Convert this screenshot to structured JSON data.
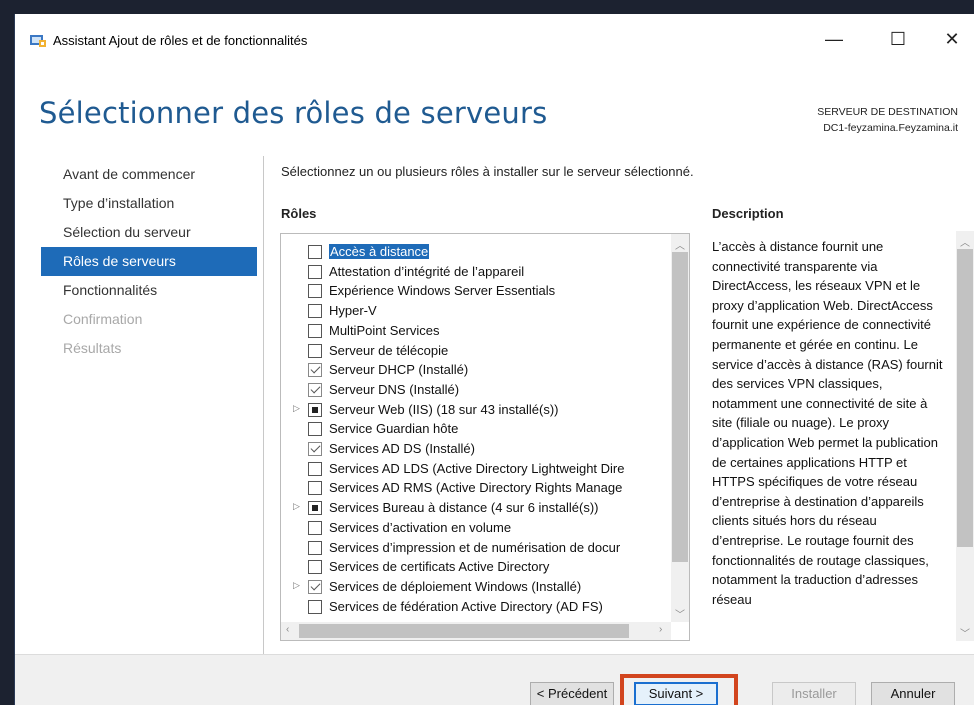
{
  "window": {
    "title": "Assistant Ajout de rôles et de fonctionnalités",
    "minimize": "—",
    "maximize": "☐",
    "close": "✕"
  },
  "header": {
    "page_title": "Sélectionner des rôles de serveurs",
    "dest_label": "SERVEUR DE DESTINATION",
    "dest_server": "DC1-feyzamina.Feyzamina.it"
  },
  "nav": {
    "items": [
      {
        "label": "Avant de commencer",
        "state": "normal"
      },
      {
        "label": "Type d’installation",
        "state": "normal"
      },
      {
        "label": "Sélection du serveur",
        "state": "normal"
      },
      {
        "label": "Rôles de serveurs",
        "state": "active"
      },
      {
        "label": "Fonctionnalités",
        "state": "normal"
      },
      {
        "label": "Confirmation",
        "state": "disabled"
      },
      {
        "label": "Résultats",
        "state": "disabled"
      }
    ]
  },
  "main": {
    "instruction": "Sélectionnez un ou plusieurs rôles à installer sur le serveur sélectionné.",
    "roles_header": "Rôles",
    "roles": [
      {
        "label": "Accès à distance",
        "check": "none",
        "expander": false,
        "selected": true
      },
      {
        "label": "Attestation d’intégrité de l’appareil",
        "check": "none",
        "expander": false
      },
      {
        "label": "Expérience Windows Server Essentials",
        "check": "none",
        "expander": false
      },
      {
        "label": "Hyper-V",
        "check": "none",
        "expander": false
      },
      {
        "label": "MultiPoint Services",
        "check": "none",
        "expander": false
      },
      {
        "label": "Serveur de télécopie",
        "check": "none",
        "expander": false
      },
      {
        "label": "Serveur DHCP (Installé)",
        "check": "installed",
        "expander": false
      },
      {
        "label": "Serveur DNS (Installé)",
        "check": "installed",
        "expander": false
      },
      {
        "label": "Serveur Web (IIS) (18 sur 43 installé(s))",
        "check": "partial",
        "expander": true
      },
      {
        "label": "Service Guardian hôte",
        "check": "none",
        "expander": false
      },
      {
        "label": "Services AD DS (Installé)",
        "check": "installed",
        "expander": false
      },
      {
        "label": "Services AD LDS (Active Directory Lightweight Dire",
        "check": "none",
        "expander": false
      },
      {
        "label": "Services AD RMS (Active Directory Rights Manage",
        "check": "none",
        "expander": false
      },
      {
        "label": "Services Bureau à distance (4 sur 6 installé(s))",
        "check": "partial",
        "expander": true
      },
      {
        "label": "Services d’activation en volume",
        "check": "none",
        "expander": false
      },
      {
        "label": "Services d’impression et de numérisation de docur",
        "check": "none",
        "expander": false
      },
      {
        "label": "Services de certificats Active Directory",
        "check": "none",
        "expander": false
      },
      {
        "label": "Services de déploiement Windows (Installé)",
        "check": "installed",
        "expander": true
      },
      {
        "label": "Services de fédération Active Directory (AD FS)",
        "check": "none",
        "expander": false
      }
    ],
    "description_header": "Description",
    "description": "L’accès à distance fournit une connectivité transparente via DirectAccess, les réseaux VPN et le proxy d’application Web. DirectAccess fournit une expérience de connectivité permanente et gérée en continu. Le service d’accès à distance (RAS) fournit des services VPN classiques, notamment une connectivité de site à site (filiale ou nuage). Le proxy d’application Web permet la publication de certaines applications HTTP et HTTPS spécifiques de votre réseau d’entreprise à destination d’appareils clients situés hors du réseau d’entreprise. Le routage fournit des fonctionnalités de routage classiques, notamment la traduction d’adresses réseau"
  },
  "footer": {
    "prev_label": "< Précédent",
    "next_label": "Suivant >",
    "install_label": "Installer",
    "cancel_label": "Annuler"
  },
  "colors": {
    "accent": "#1e6bb8",
    "title_blue": "#1f5a91",
    "highlight_box": "#d2451e"
  }
}
